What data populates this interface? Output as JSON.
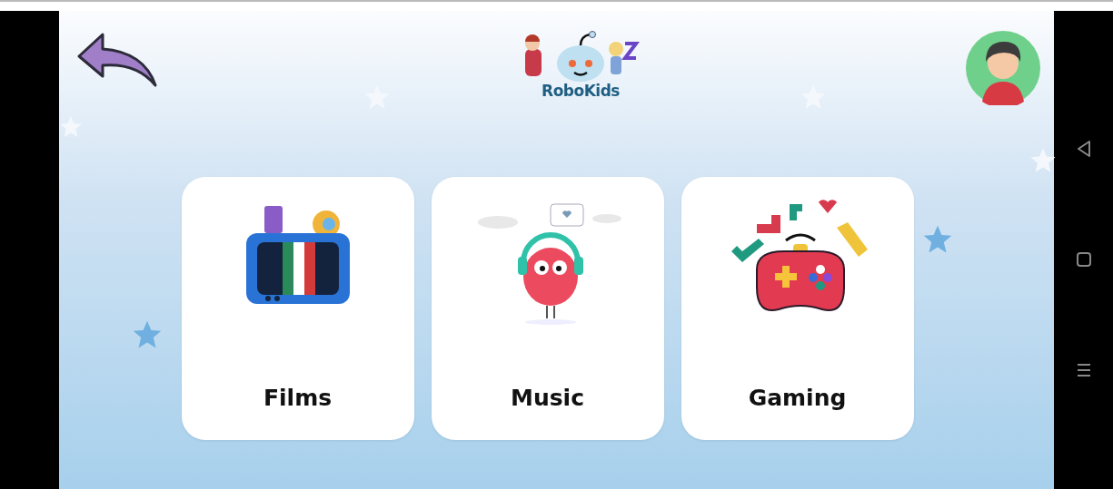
{
  "header": {
    "logo_text": "RoboKids"
  },
  "categories": [
    {
      "kind": "films",
      "label": "Films"
    },
    {
      "kind": "music",
      "label": "Music"
    },
    {
      "kind": "gaming",
      "label": "Gaming"
    }
  ]
}
